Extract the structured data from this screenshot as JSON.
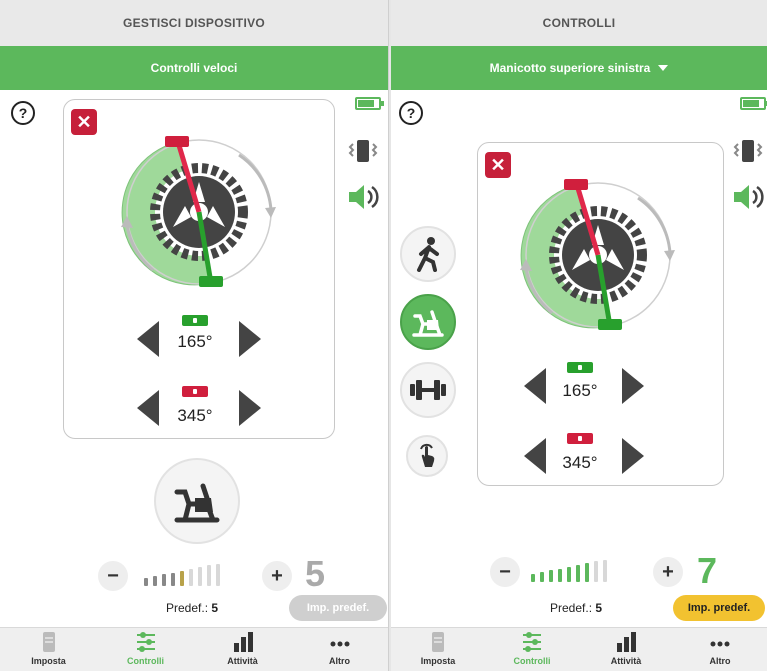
{
  "left": {
    "header": "GESTISCI DISPOSITIVO",
    "green_bar": "Controlli veloci",
    "help_label": "?",
    "close_label": "✕",
    "green_angle": "165°",
    "red_angle": "345°",
    "level": {
      "minus": "−",
      "plus": "+",
      "value": "5",
      "value_color": "#aaaaaa",
      "filled": 5,
      "total": 9
    },
    "predef_label": "Predef.:",
    "predef_value": "5",
    "imp_button": "Imp. predef."
  },
  "right": {
    "header": "CONTROLLI",
    "green_bar": "Manicotto superiore sinistra",
    "help_label": "?",
    "close_label": "✕",
    "green_angle": "165°",
    "red_angle": "345°",
    "modes": [
      "walk-icon",
      "bike-icon",
      "dumbbell-icon",
      "touch-icon"
    ],
    "level": {
      "minus": "−",
      "plus": "+",
      "value": "7",
      "value_color": "#5cb85c",
      "filled": 7,
      "total": 9
    },
    "predef_label": "Predef.:",
    "predef_value": "5",
    "imp_button": "Imp. predef."
  },
  "tabs": [
    {
      "label": "Imposta",
      "icon": "device-icon"
    },
    {
      "label": "Controlli",
      "icon": "sliders-icon"
    },
    {
      "label": "Attività",
      "icon": "bar-chart-icon"
    },
    {
      "label": "Altro",
      "icon": "more-icon"
    }
  ],
  "colors": {
    "green": "#5cb85c",
    "red": "#c6203a",
    "yellow": "#f2c230"
  }
}
